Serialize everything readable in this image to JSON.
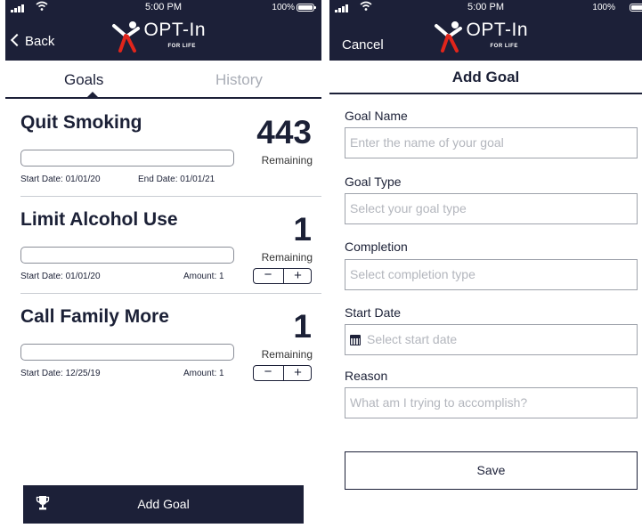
{
  "status_bar": {
    "time": "5:00 PM",
    "battery": "100%"
  },
  "logo": {
    "name": "OPT-In",
    "tagline": "FOR LIFE"
  },
  "goals_screen": {
    "back_label": "Back",
    "tabs": [
      {
        "label": "Goals",
        "active": true
      },
      {
        "label": "History",
        "active": false
      }
    ],
    "goals": [
      {
        "name": "Quit Smoking",
        "count": "443",
        "remaining_label": "Remaining",
        "start": "Start Date: 01/01/20",
        "end": "End Date: 01/01/21",
        "amount": "",
        "progress": 0
      },
      {
        "name": "Limit Alcohol Use",
        "count": "1",
        "remaining_label": "Remaining",
        "start": "Start Date: 01/01/20",
        "end": "",
        "amount": "Amount: 1",
        "progress": 0
      },
      {
        "name": "Call Family More",
        "count": "1",
        "remaining_label": "Remaining",
        "start": "Start Date: 12/25/19",
        "end": "",
        "amount": "Amount: 1",
        "progress": 0
      }
    ],
    "stepper": {
      "minus": "−",
      "plus": "+"
    },
    "add_goal_label": "Add Goal"
  },
  "add_goal_screen": {
    "cancel_label": "Cancel",
    "title": "Add Goal",
    "fields": [
      {
        "label": "Goal Name",
        "placeholder": "Enter the name of your goal"
      },
      {
        "label": "Goal Type",
        "placeholder": "Select your goal type"
      },
      {
        "label": "Completion",
        "placeholder": "Select completion type"
      },
      {
        "label": "Start Date",
        "placeholder": "Select start date"
      },
      {
        "label": "Reason",
        "placeholder": "What am I trying to accomplish?"
      }
    ],
    "save_label": "Save"
  },
  "colors": {
    "navy": "#1c2038",
    "logo_red": "#e1251b",
    "muted_text": "#a9adb6"
  }
}
